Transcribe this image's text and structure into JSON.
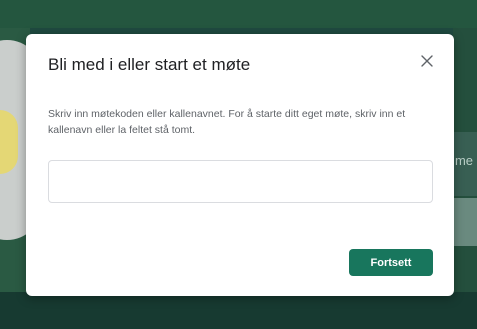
{
  "dialog": {
    "title": "Bli med i eller start et møte",
    "description": "Skriv inn møtekoden eller kallenavnet. For å starte ditt eget møte, skriv inn et kallenavn eller la feltet stå tomt.",
    "input": {
      "value": "",
      "placeholder": ""
    },
    "continue_label": "Fortsett"
  },
  "background": {
    "partial_text": "me"
  },
  "icons": {
    "close": "close-icon"
  },
  "colors": {
    "accent": "#18765d",
    "background": "#1f4a40"
  }
}
